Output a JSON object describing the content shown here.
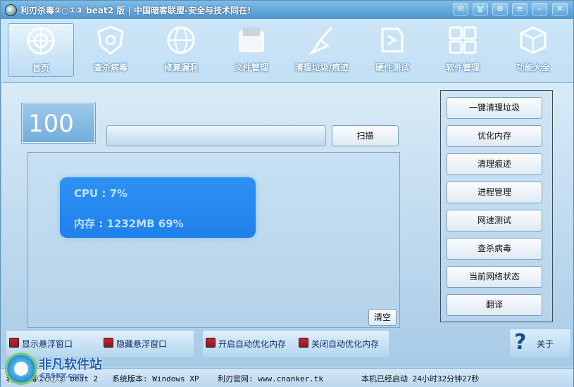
{
  "titlebar": {
    "title": "利刃杀毒②○①③ beat2 版 | 中国暗客联盟-安全与技术同在!",
    "buttons": [
      "feedback-icon",
      "skin-icon",
      "settings-icon",
      "menu-icon",
      "minimize-icon",
      "close-icon"
    ]
  },
  "toolbar": {
    "items": [
      {
        "label": "首页",
        "icon": "home-target-icon"
      },
      {
        "label": "查杀病毒",
        "icon": "shield-virus-icon"
      },
      {
        "label": "修复漏洞",
        "icon": "repair-globe-icon"
      },
      {
        "label": "文件管理",
        "icon": "file-folder-icon"
      },
      {
        "label": "清理垃圾/痕迹",
        "icon": "broom-icon"
      },
      {
        "label": "硬件测试",
        "icon": "hardware-icon"
      },
      {
        "label": "软件管理",
        "icon": "grid-apps-icon"
      },
      {
        "label": "功能大全",
        "icon": "box-icon"
      }
    ]
  },
  "main": {
    "score": "100",
    "scan_label": "扫描",
    "clear_label": "清空",
    "stats": {
      "cpu": "CPU : 7%",
      "memory": "内存 : 1232MB   69%"
    }
  },
  "side": {
    "buttons": [
      "一键清理垃圾",
      "优化内存",
      "清理痕迹",
      "进程管理",
      "网速测试",
      "查杀病毒",
      "当前网络状态",
      "翻译"
    ]
  },
  "bottom": {
    "show_float": "显示悬浮窗口",
    "hide_float": "隐藏悬浮窗口",
    "enable_auto": "开启自动优化内存",
    "disable_auto": "关闭自动优化内存",
    "about": "关于"
  },
  "status": {
    "app": "利刃杀毒②○①③ beat 2",
    "version": "系统版本: Windows XP",
    "site": "利刃官网: www.cnanker.tk",
    "uptime": "本机已经启动 24小时32分钟27秒"
  },
  "watermark": {
    "text": "非凡软件站",
    "sub": "CRSKY.com"
  }
}
